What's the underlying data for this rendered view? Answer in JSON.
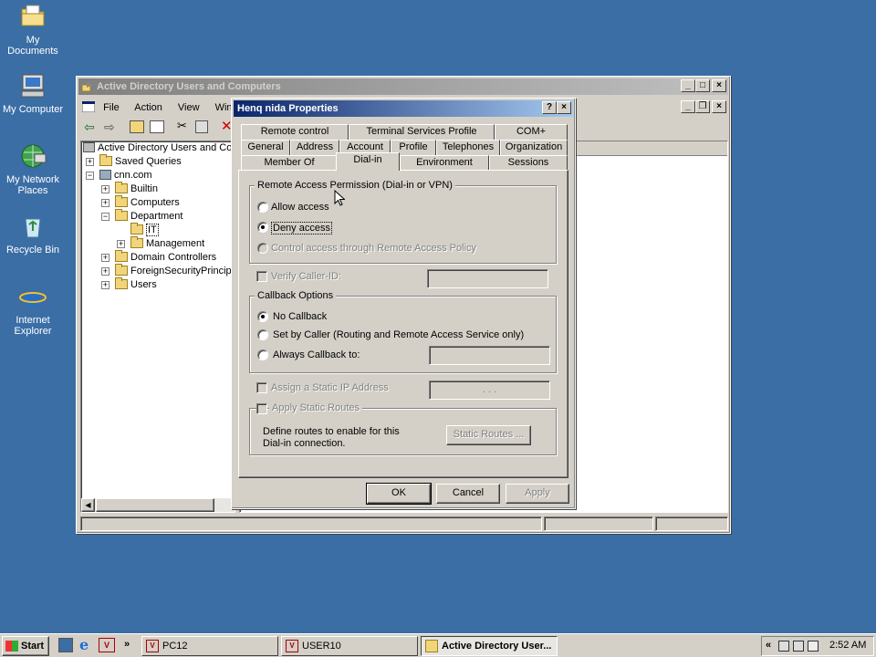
{
  "desktop": {
    "icons": [
      {
        "label": "My Documents"
      },
      {
        "label": "My Computer"
      },
      {
        "label": "My Network Places"
      },
      {
        "label": "Recycle Bin"
      },
      {
        "label": "Internet Explorer"
      }
    ]
  },
  "aduc": {
    "title": "Active Directory Users and Computers",
    "menu": [
      "File",
      "Action",
      "View",
      "Window"
    ],
    "tree": [
      {
        "label": "Active Directory Users and Comp"
      },
      {
        "label": "Saved Queries"
      },
      {
        "label": "cnn.com"
      },
      {
        "label": "Builtin"
      },
      {
        "label": "Computers"
      },
      {
        "label": "Department"
      },
      {
        "label": "IT"
      },
      {
        "label": "Management"
      },
      {
        "label": "Domain Controllers"
      },
      {
        "label": "ForeignSecurityPrincipals"
      },
      {
        "label": "Users"
      }
    ]
  },
  "dialog": {
    "title": "Henq nida Properties",
    "help": "?",
    "close": "×",
    "tabs_row1": [
      "Remote control",
      "Terminal Services Profile",
      "COM+"
    ],
    "tabs_row2": [
      "General",
      "Address",
      "Account",
      "Profile",
      "Telephones",
      "Organization"
    ],
    "tabs_row3": [
      "Member Of",
      "Dial-in",
      "Environment",
      "Sessions"
    ],
    "selected_tab": "Dial-in",
    "remote_access": {
      "group_label": "Remote Access Permission (Dial-in or VPN)",
      "allow": "Allow access",
      "deny": "Deny access",
      "control": "Control access through Remote Access Policy",
      "selected": "Deny access"
    },
    "verify_caller_id": "Verify Caller-ID:",
    "callback": {
      "group_label": "Callback Options",
      "no_callback": "No Callback",
      "set_by_caller": "Set by Caller (Routing and Remote Access Service only)",
      "always": "Always Callback to:",
      "selected": "No Callback"
    },
    "static_ip": "Assign a Static IP Address",
    "static_ip_value": ".   .   .",
    "static_routes": {
      "label": "Apply Static Routes",
      "description": "Define routes to enable for this Dial-in connection.",
      "button": "Static Routes ..."
    },
    "buttons": {
      "ok": "OK",
      "cancel": "Cancel",
      "apply": "Apply"
    }
  },
  "taskbar": {
    "start": "Start",
    "quicklaunch_more": "»",
    "tasks": [
      {
        "label": "PC12"
      },
      {
        "label": "USER10"
      },
      {
        "label": "Active Directory User..."
      }
    ],
    "tray_more": "«",
    "clock": "2:52 AM"
  }
}
